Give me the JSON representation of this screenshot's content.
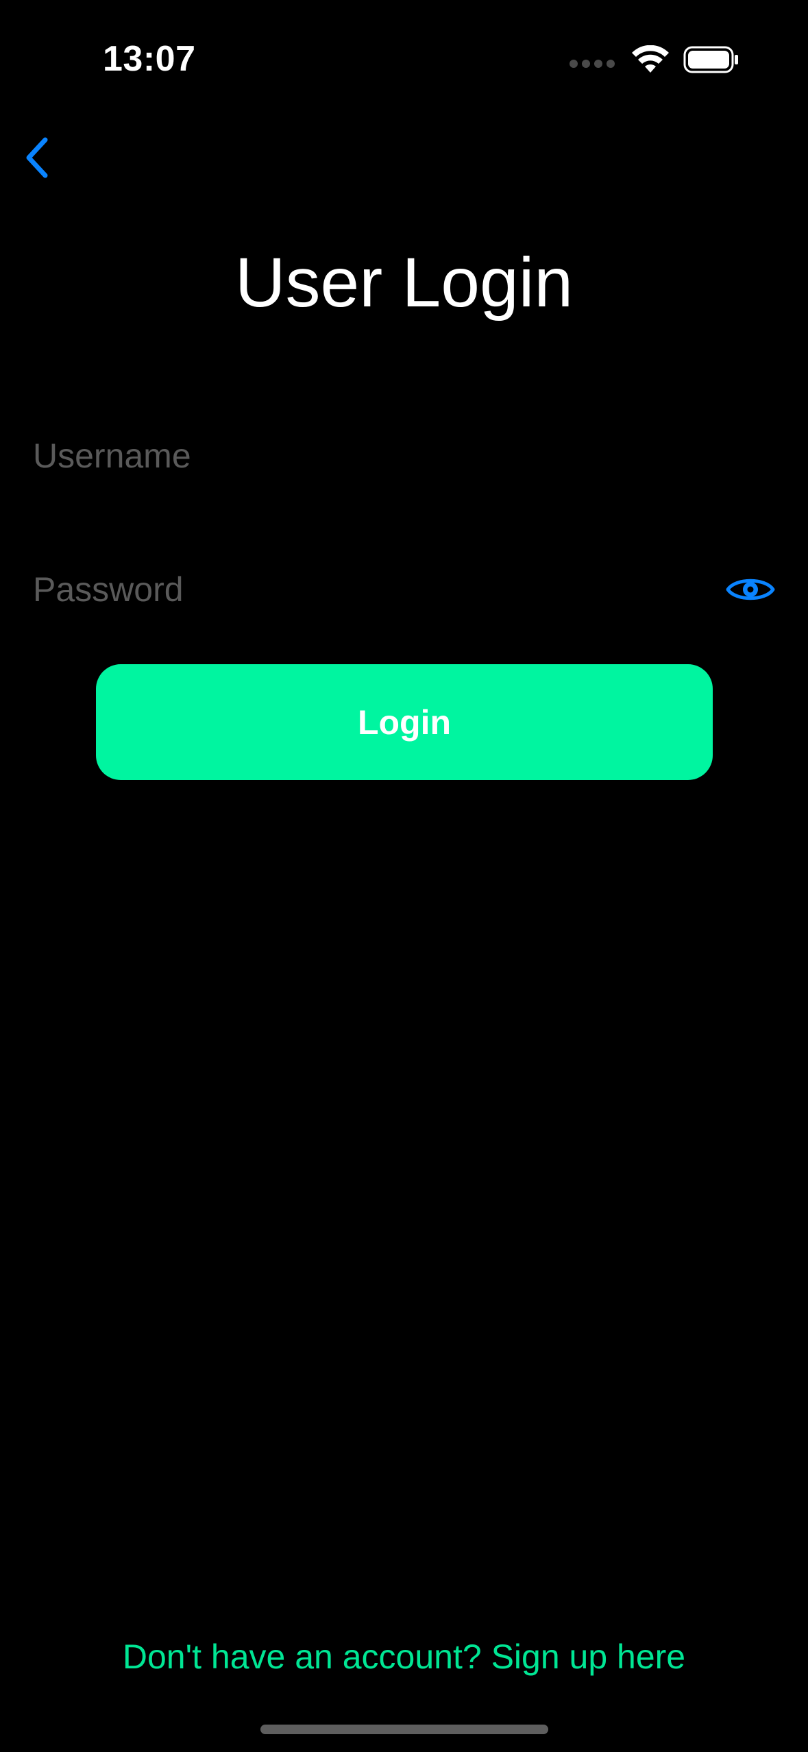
{
  "status_bar": {
    "time": "13:07",
    "icons": [
      "cellular-signal-icon",
      "wifi-icon",
      "battery-icon"
    ]
  },
  "nav": {
    "back_icon": "chevron-left-icon"
  },
  "page": {
    "title": "User Login"
  },
  "form": {
    "username": {
      "value": "",
      "placeholder": "Username"
    },
    "password": {
      "value": "",
      "placeholder": "Password",
      "toggle_icon": "eye-icon"
    },
    "login_label": "Login"
  },
  "footer": {
    "signup_text": "Don't have an account? Sign up here"
  },
  "colors": {
    "background": "#000000",
    "accent": "#00f5a0",
    "link": "#00e694",
    "icon_blue": "#0a84ff",
    "placeholder": "#5a5a5a"
  }
}
